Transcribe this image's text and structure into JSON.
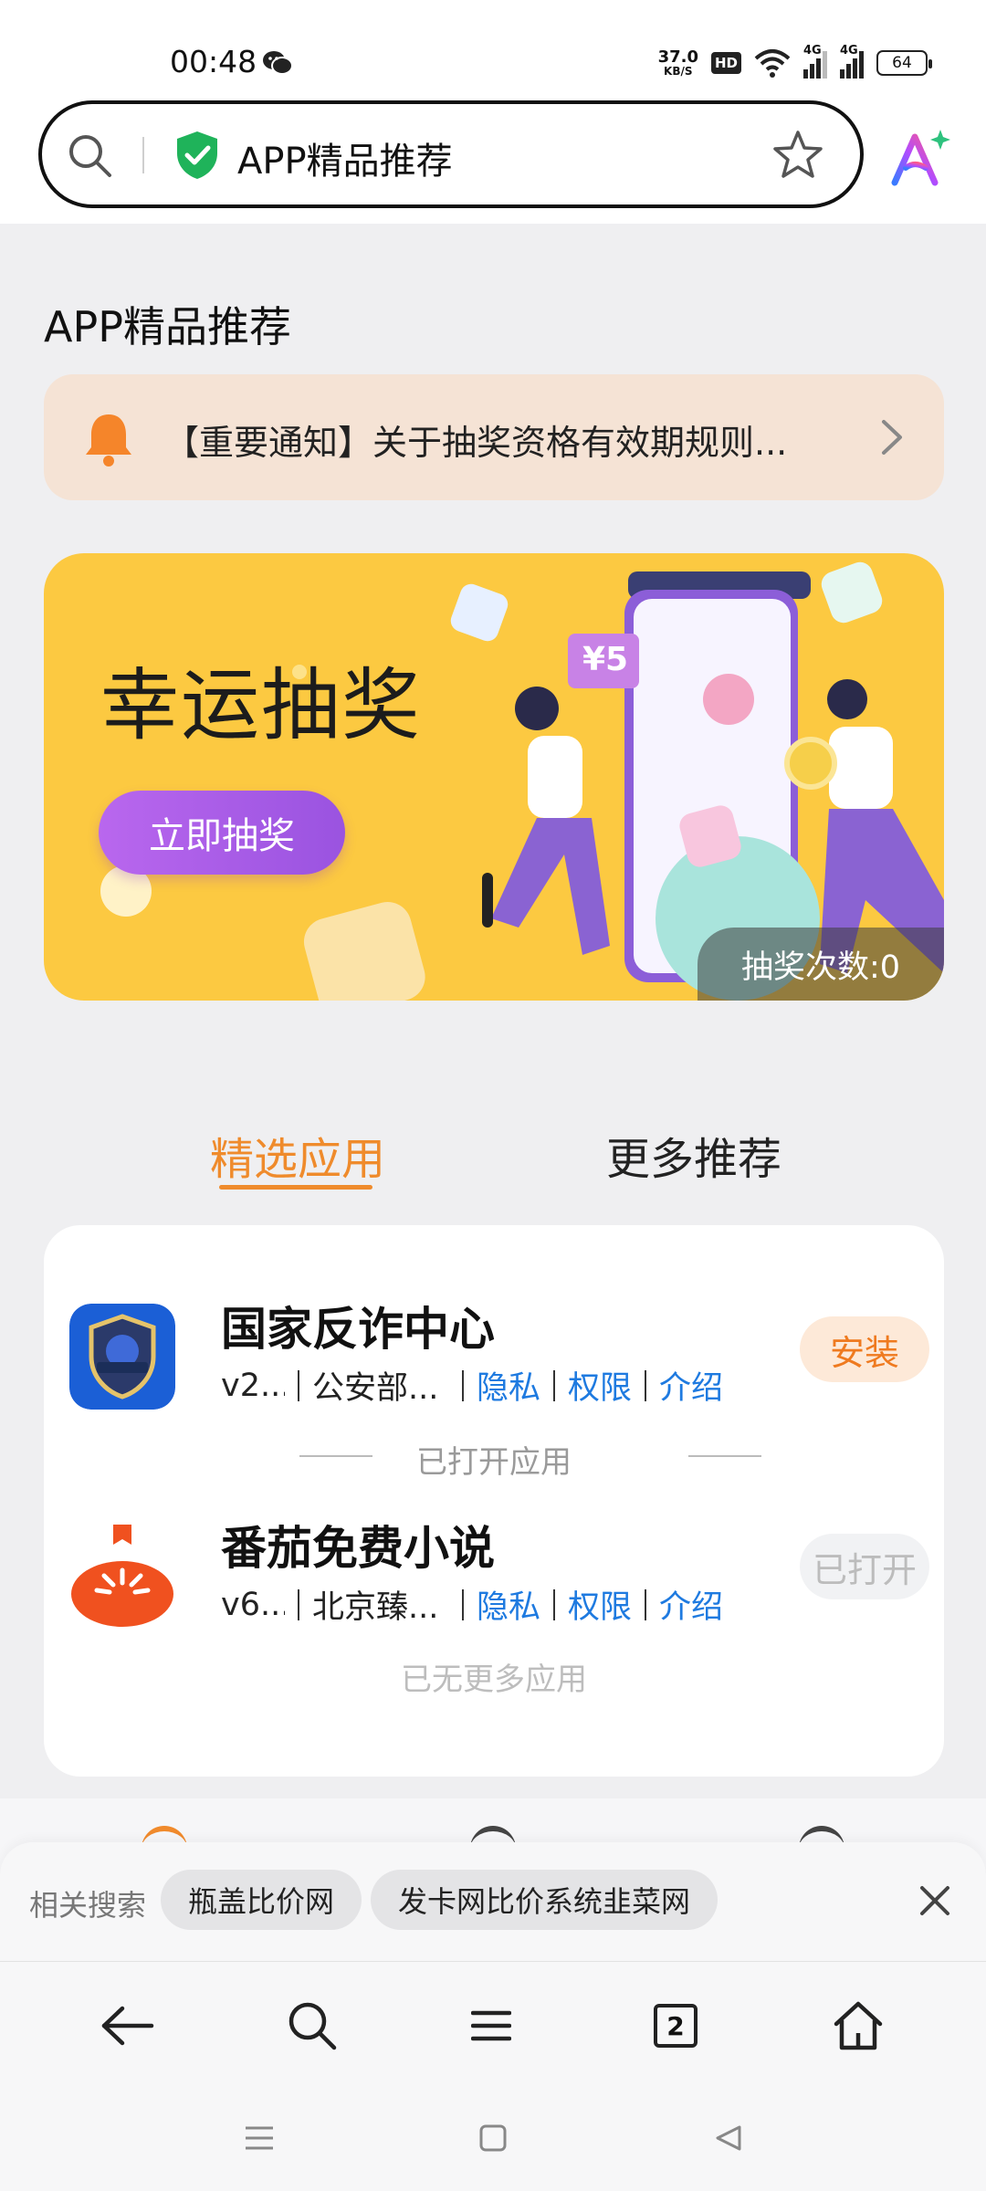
{
  "status_bar": {
    "time": "00:48",
    "net_speed_value": "37.0",
    "net_speed_unit": "KB/S",
    "hd_label": "HD",
    "signal1_label": "4G",
    "signal2_label": "4G",
    "battery": "64"
  },
  "address_bar": {
    "url_title": "APP精品推荐"
  },
  "page": {
    "title": "APP精品推荐",
    "notice": "【重要通知】关于抽奖资格有效期规则...",
    "banner": {
      "title": "幸运抽奖",
      "button_label": "立即抽奖",
      "yuan_tag": "¥5",
      "draw_count": "抽奖次数:0"
    },
    "tabs": [
      {
        "label": "精选应用",
        "selected": true
      },
      {
        "label": "更多推荐",
        "selected": false
      }
    ],
    "apps": [
      {
        "name": "国家反诈中心",
        "version": "v2...",
        "developer": "公安部...",
        "privacy": "隐私",
        "permissions": "权限",
        "intro": "介绍",
        "action": "安装"
      },
      {
        "name": "番茄免费小说",
        "version": "v6...",
        "developer": "北京臻...",
        "privacy": "隐私",
        "permissions": "权限",
        "intro": "介绍",
        "action": "已打开"
      }
    ],
    "opened_divider": "已打开应用",
    "no_more": "已无更多应用"
  },
  "related": {
    "label": "相关搜索",
    "chips": [
      "瓶盖比价网",
      "发卡网比价系统韭菜网"
    ]
  },
  "toolbar": {
    "tab_count": "2"
  },
  "colors": {
    "accent_orange": "#ef8b2c",
    "link_blue": "#1e7ae0",
    "banner_yellow": "#fcc941",
    "button_purple": "#b967ee"
  }
}
